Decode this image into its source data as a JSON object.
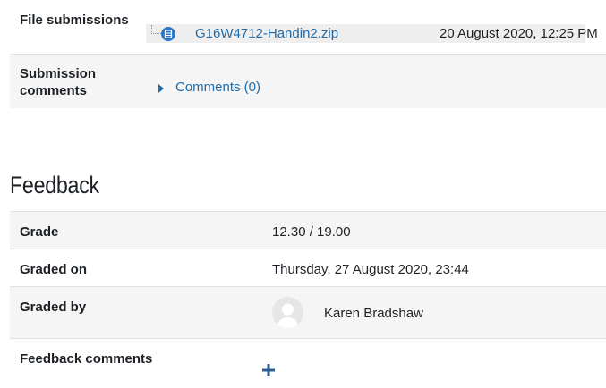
{
  "submission": {
    "file_label": "File submissions",
    "file_name": "G16W4712-Handin2.zip",
    "file_date": "20 August 2020, 12:25 PM",
    "comments_label_line1": "Submission",
    "comments_label_line2": "comments",
    "comments_link": "Comments (0)"
  },
  "feedback": {
    "heading": "Feedback",
    "grade_label": "Grade",
    "grade_value": "12.30 / 19.00",
    "graded_on_label": "Graded on",
    "graded_on_value": "Thursday, 27 August 2020, 23:44",
    "graded_by_label": "Graded by",
    "graded_by_name": "Karen Bradshaw",
    "comments_label": "Feedback comments"
  },
  "colors": {
    "link": "#1f6aa8",
    "stripe": "#f5f5f5",
    "border": "#dee2e6",
    "file_icon": "#2b77c4"
  },
  "icons": {
    "file": "archive-file-icon",
    "expand": "caret-right-icon",
    "avatar": "default-user-avatar",
    "add": "plus-icon"
  }
}
